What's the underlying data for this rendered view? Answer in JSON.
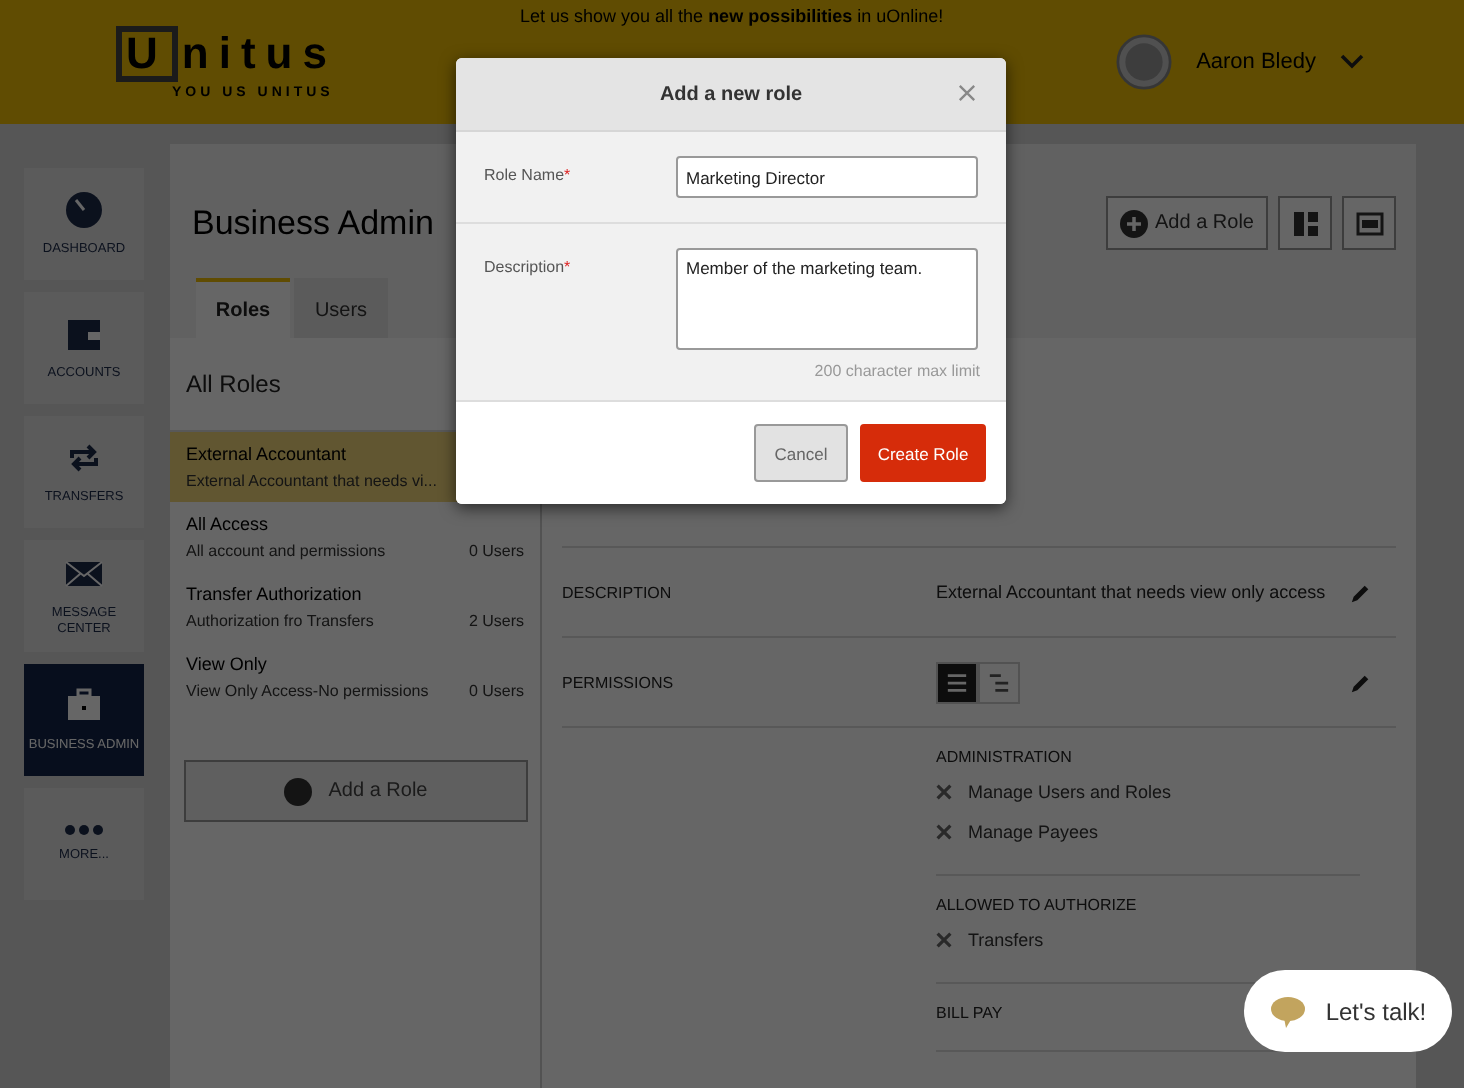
{
  "banner": "Let us show you all the **new possibilities** in uOnline!",
  "logo": {
    "boxed_letter": "U",
    "rest": "nitus",
    "tagline": "YOU US UNITUS"
  },
  "user": {
    "name": "Aaron Bledy"
  },
  "nav": [
    {
      "label": "DASHBOARD",
      "kind": "gauge",
      "selected": false
    },
    {
      "label": "ACCOUNTS",
      "kind": "wallet",
      "selected": false
    },
    {
      "label": "TRANSFERS",
      "kind": "transfer",
      "selected": false
    },
    {
      "label": "MESSAGE CENTER",
      "kind": "mail",
      "selected": false
    },
    {
      "label": "BUSINESS ADMIN",
      "kind": "briefcase",
      "selected": true
    },
    {
      "label": "MORE...",
      "kind": "more",
      "selected": false
    }
  ],
  "page": {
    "title": "Business Admin",
    "toolbar_button": "Add a Role"
  },
  "tabs": [
    {
      "label": "Roles",
      "selected": true
    },
    {
      "label": "Users",
      "selected": false
    }
  ],
  "roles": {
    "heading": "All Roles",
    "items": [
      {
        "name": "External Accountant",
        "description": "External Accountant that needs vi...",
        "selected": true
      },
      {
        "name": "All Access",
        "description": "All account and permissions",
        "users": "0 Users",
        "selected": false
      },
      {
        "name": "Transfer Authorization",
        "description": "Authorization fro Transfers",
        "users": "2 Users",
        "selected": false
      },
      {
        "name": "View Only",
        "description": "View Only Access-No permissions",
        "users": "0 Users",
        "selected": false
      }
    ],
    "add_button": "Add a Role"
  },
  "details": {
    "description_label": "DESCRIPTION",
    "description_value": "External Accountant that needs view only access",
    "permissions_label": "PERMISSIONS",
    "view_modes": [
      {
        "kind": "list",
        "selected": true
      },
      {
        "kind": "tree",
        "selected": false
      }
    ],
    "sections": [
      {
        "title": "ADMINISTRATION",
        "items": [
          "Manage Users and Roles",
          "Manage Payees"
        ]
      },
      {
        "title": "ALLOWED TO AUTHORIZE",
        "items": [
          "Transfers"
        ]
      },
      {
        "title": "BILL PAY"
      }
    ]
  },
  "modal": {
    "title": "Add a new role",
    "fields": [
      {
        "label": "Role Name",
        "required_mark": "*",
        "kind": "text",
        "value": "Marketing Director"
      },
      {
        "label": "Description",
        "required_mark": "*",
        "kind": "textarea",
        "value": "Member of the marketing team.",
        "hint": "200 character max limit"
      }
    ],
    "buttons": [
      {
        "label": "Cancel",
        "kind": "secondary"
      },
      {
        "label": "Create Role",
        "kind": "primary"
      }
    ]
  },
  "chat": {
    "label": "Let's talk!"
  }
}
